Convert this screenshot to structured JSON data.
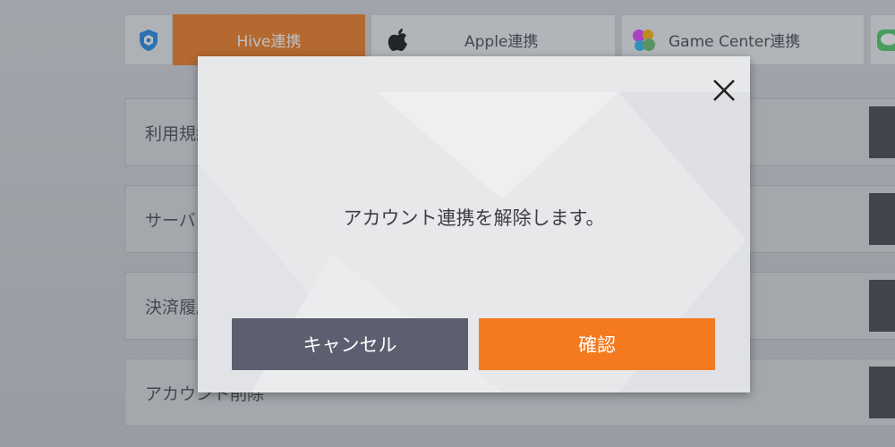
{
  "tabs": {
    "hive_label": "Hive連携",
    "apple_label": "Apple連携",
    "gamecenter_label": "Game Center連携"
  },
  "rows": [
    {
      "label": "利用規約"
    },
    {
      "label": "サーバー"
    },
    {
      "label": "決済履歴"
    },
    {
      "label": "アカウント削除"
    }
  ],
  "dialog": {
    "message": "アカウント連携を解除します。",
    "cancel_label": "キャンセル",
    "confirm_label": "確認"
  },
  "colors": {
    "accent_orange": "#f57a1f",
    "cancel_gray": "#5b5f6f"
  },
  "icons": {
    "close": "close-icon",
    "apple": "apple-icon",
    "gamecenter": "game-center-icon",
    "hive": "hive-shield-icon"
  }
}
